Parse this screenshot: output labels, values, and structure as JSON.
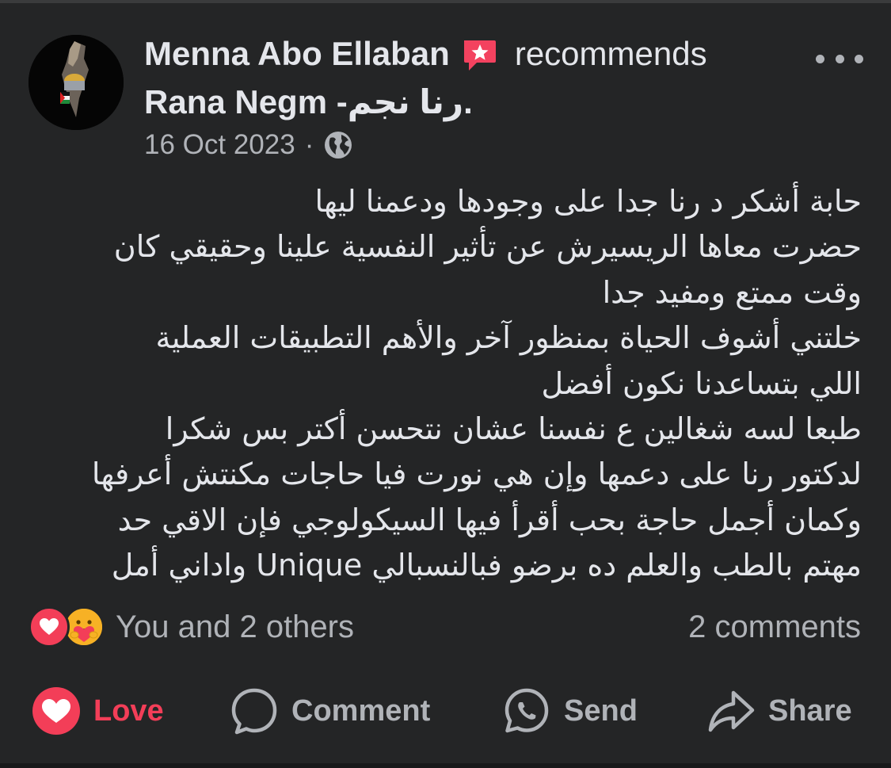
{
  "post": {
    "author": "Menna Abo Ellaban",
    "action": "recommends",
    "page_name": "Rana Negm -رنا نجم.",
    "date": "16 Oct 2023",
    "separator": "·",
    "privacy_icon": "globe-icon",
    "body_lines": [
      "حابة أشكر د رنا جدا على وجودها ودعمنا ليها",
      "حضرت معاها الريسيرش عن تأثير النفسية علينا وحقيقي كان",
      "وقت ممتع ومفيد جدا",
      "خلتني أشوف الحياة بمنظور آخر والأهم التطبيقات العملية",
      "اللي بتساعدنا نكون أفضل",
      "طبعا لسه شغالين ع نفسنا عشان نتحسن أكتر بس شكرا",
      "لدكتور رنا على دعمها وإن هي نورت فيا حاجات مكنتش أعرفها",
      "وكمان أجمل حاجة بحب أقرأ فيها السيكولوجي فإن الاقي حد",
      "مهتم بالطب والعلم ده برضو فبالنسبالي Unique واداني أمل"
    ]
  },
  "reactions": {
    "icons": [
      "love-reaction-icon",
      "care-reaction-icon"
    ],
    "summary": "You and 2 others",
    "comments": "2 comments"
  },
  "actions": {
    "love": "Love",
    "comment": "Comment",
    "send": "Send",
    "share": "Share"
  },
  "colors": {
    "background": "#242526",
    "text": "#e4e6eb",
    "muted": "#b0b3b8",
    "love": "#f33e58",
    "badge": "#f3425f"
  }
}
